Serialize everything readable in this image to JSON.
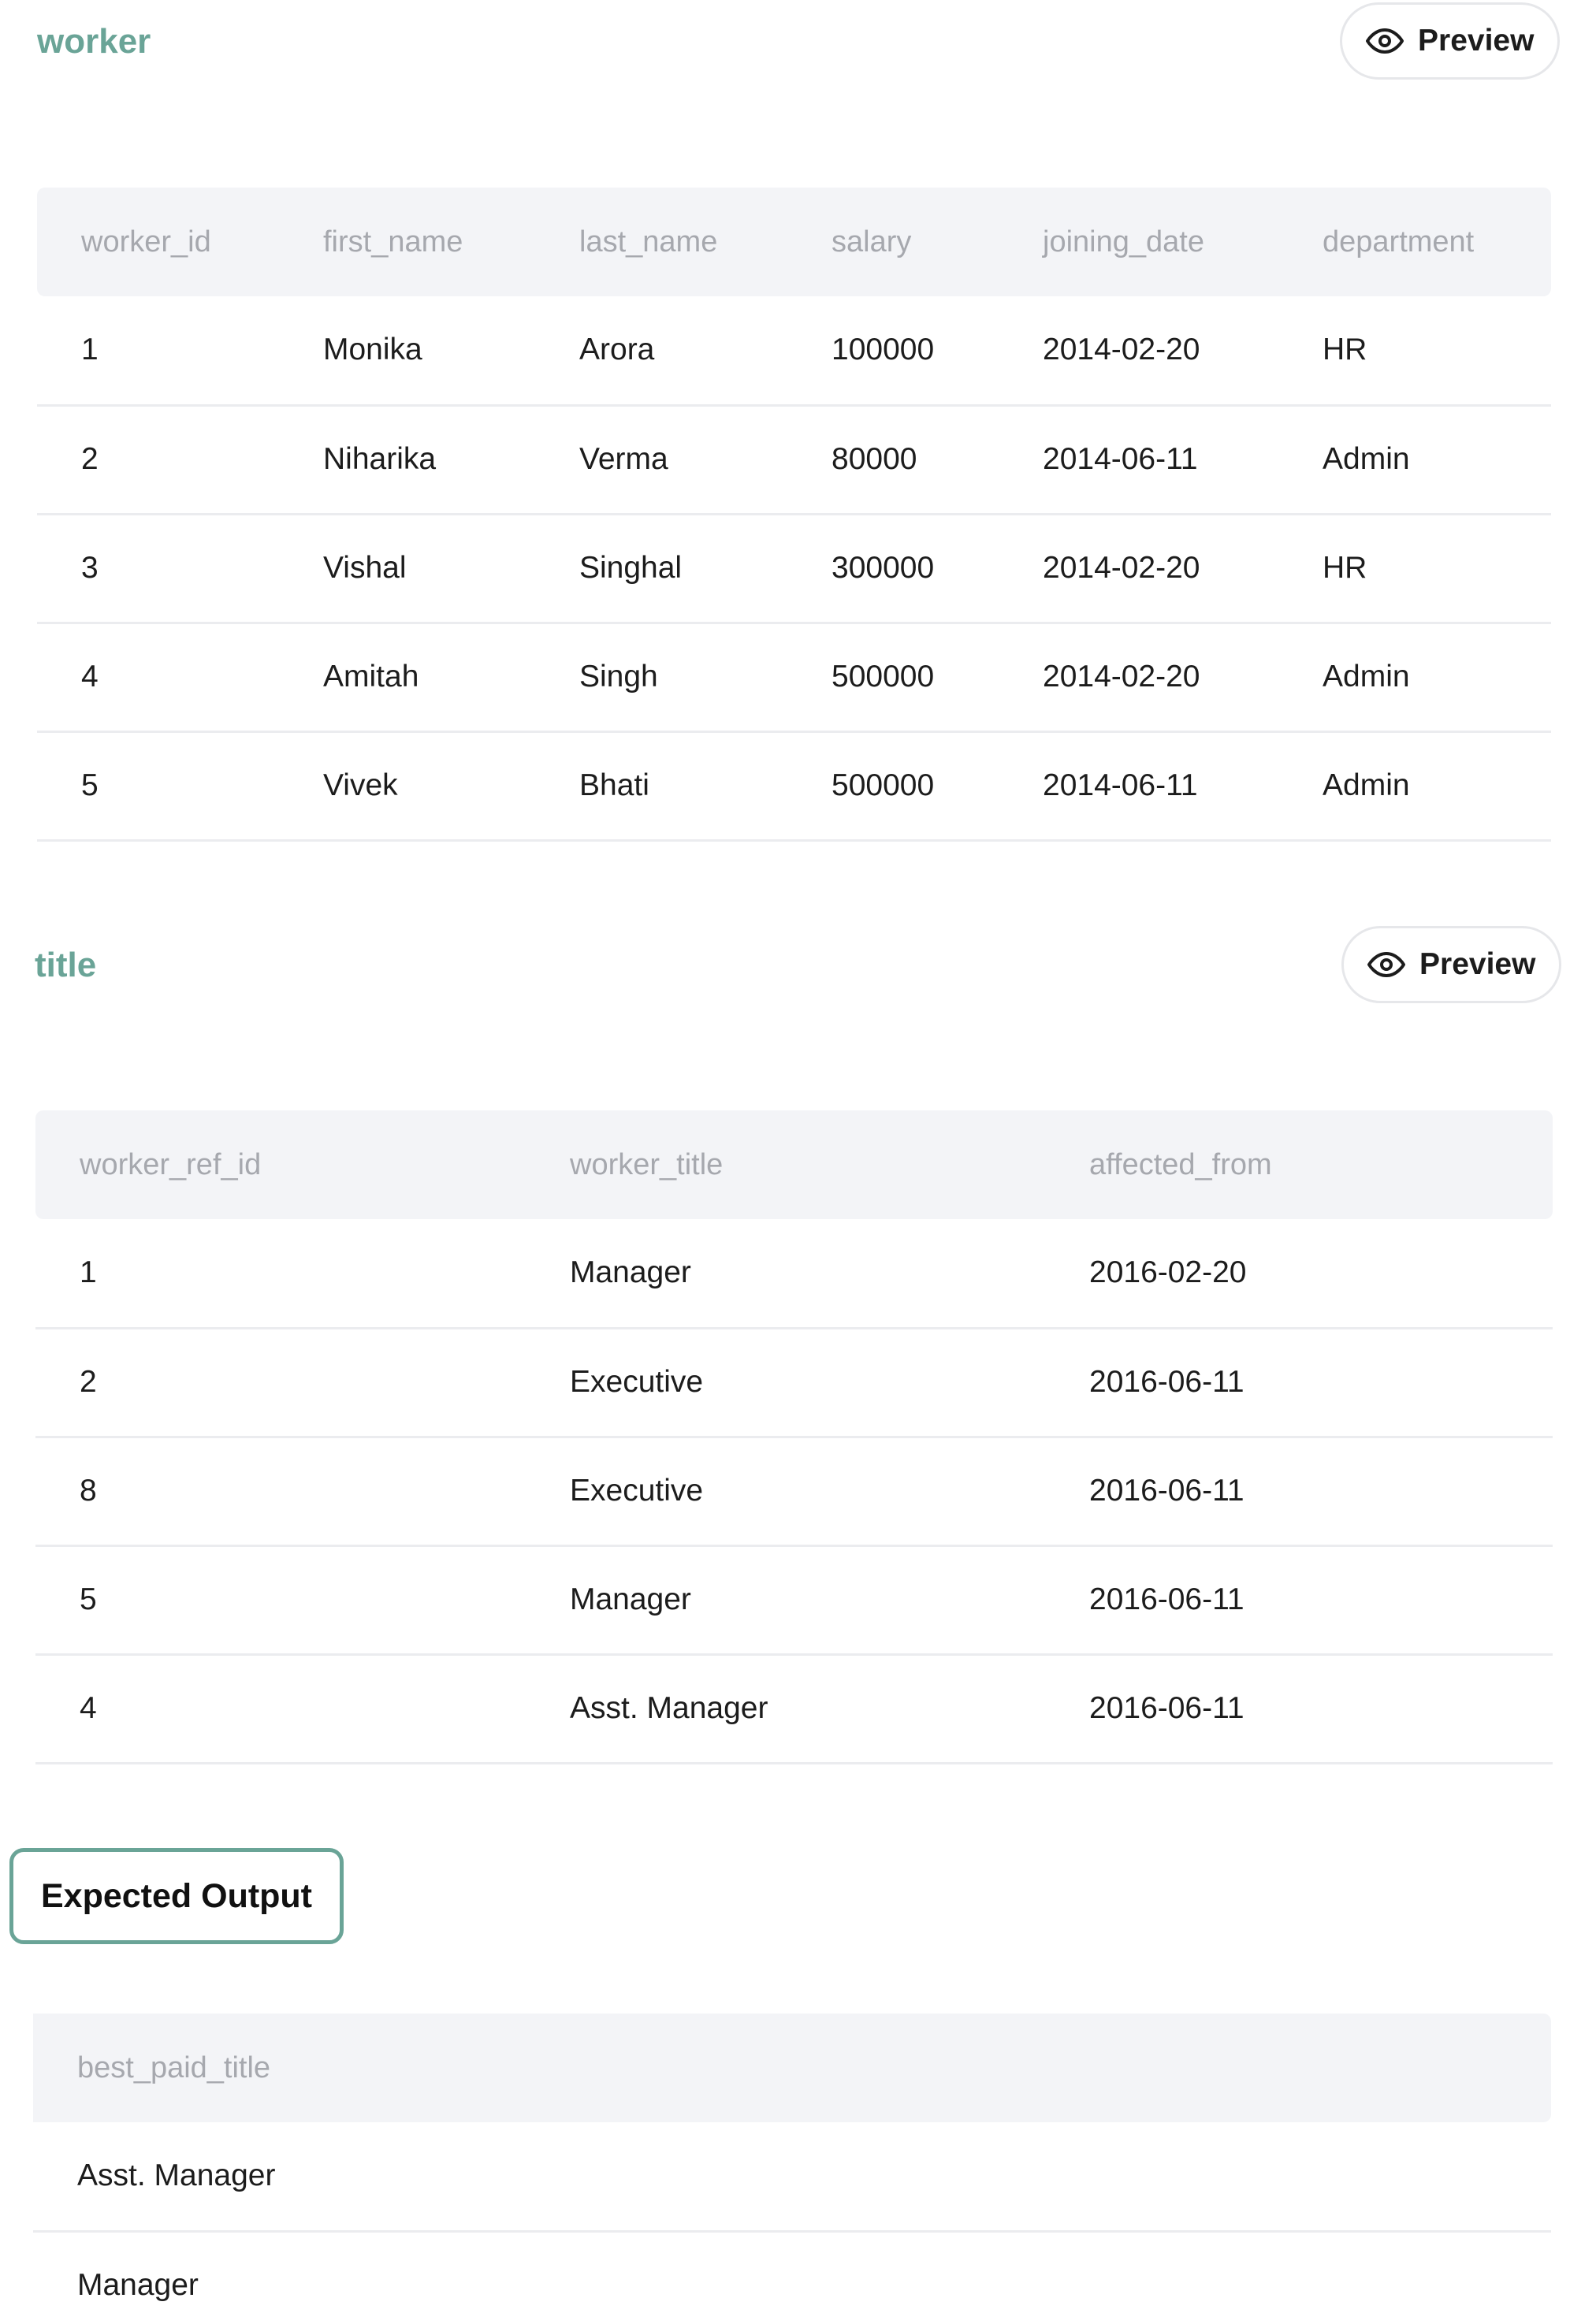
{
  "worker": {
    "title": "worker",
    "preview_label": "Preview",
    "columns": [
      "worker_id",
      "first_name",
      "last_name",
      "salary",
      "joining_date",
      "department"
    ],
    "rows": [
      [
        "1",
        "Monika",
        "Arora",
        "100000",
        "2014-02-20",
        "HR"
      ],
      [
        "2",
        "Niharika",
        "Verma",
        "80000",
        "2014-06-11",
        "Admin"
      ],
      [
        "3",
        "Vishal",
        "Singhal",
        "300000",
        "2014-02-20",
        "HR"
      ],
      [
        "4",
        "Amitah",
        "Singh",
        "500000",
        "2014-02-20",
        "Admin"
      ],
      [
        "5",
        "Vivek",
        "Bhati",
        "500000",
        "2014-06-11",
        "Admin"
      ]
    ]
  },
  "title_table": {
    "title": "title",
    "preview_label": "Preview",
    "columns": [
      "worker_ref_id",
      "worker_title",
      "affected_from"
    ],
    "rows": [
      [
        "1",
        "Manager",
        "2016-02-20"
      ],
      [
        "2",
        "Executive",
        "2016-06-11"
      ],
      [
        "8",
        "Executive",
        "2016-06-11"
      ],
      [
        "5",
        "Manager",
        "2016-06-11"
      ],
      [
        "4",
        "Asst. Manager",
        "2016-06-11"
      ]
    ]
  },
  "expected_output": {
    "label": "Expected Output",
    "columns": [
      "best_paid_title"
    ],
    "rows": [
      [
        "Asst. Manager"
      ],
      [
        "Manager"
      ]
    ]
  },
  "colors": {
    "accent": "#6aa497",
    "header_bg": "#f3f4f7",
    "header_text": "#a6a8ae",
    "row_border": "#ebecef"
  },
  "icons": {
    "preview": "eye-icon"
  }
}
